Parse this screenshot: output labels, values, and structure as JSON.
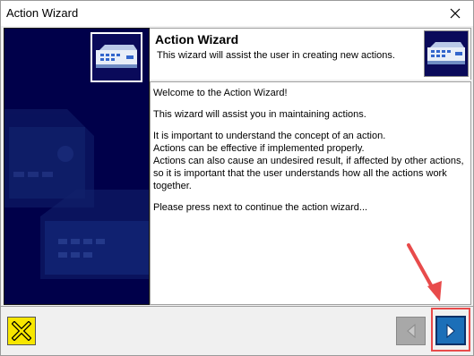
{
  "window": {
    "title": "Action Wizard"
  },
  "header": {
    "title": "Action Wizard",
    "subtitle": "This wizard will assist the user in creating new actions."
  },
  "content": {
    "lines": [
      "Welcome to the Action Wizard!",
      "This wizard will assist you in maintaining actions.",
      "It is important to understand the concept of an action.",
      "Actions can be effective if implemented properly.",
      "Actions can also cause an undesired result, if affected by other actions, so it is important that the user understands how all the actions work together.",
      "Please press next to continue the action wizard..."
    ]
  },
  "buttons": {
    "cancel_icon": "x-icon",
    "back_icon": "chevron-left-icon",
    "next_icon": "chevron-right-icon"
  },
  "colors": {
    "sidebar_bg": "#00004a",
    "cancel_bg": "#f7e600",
    "next_bg": "#1c6fb8",
    "annotation": "#e84b4b"
  }
}
